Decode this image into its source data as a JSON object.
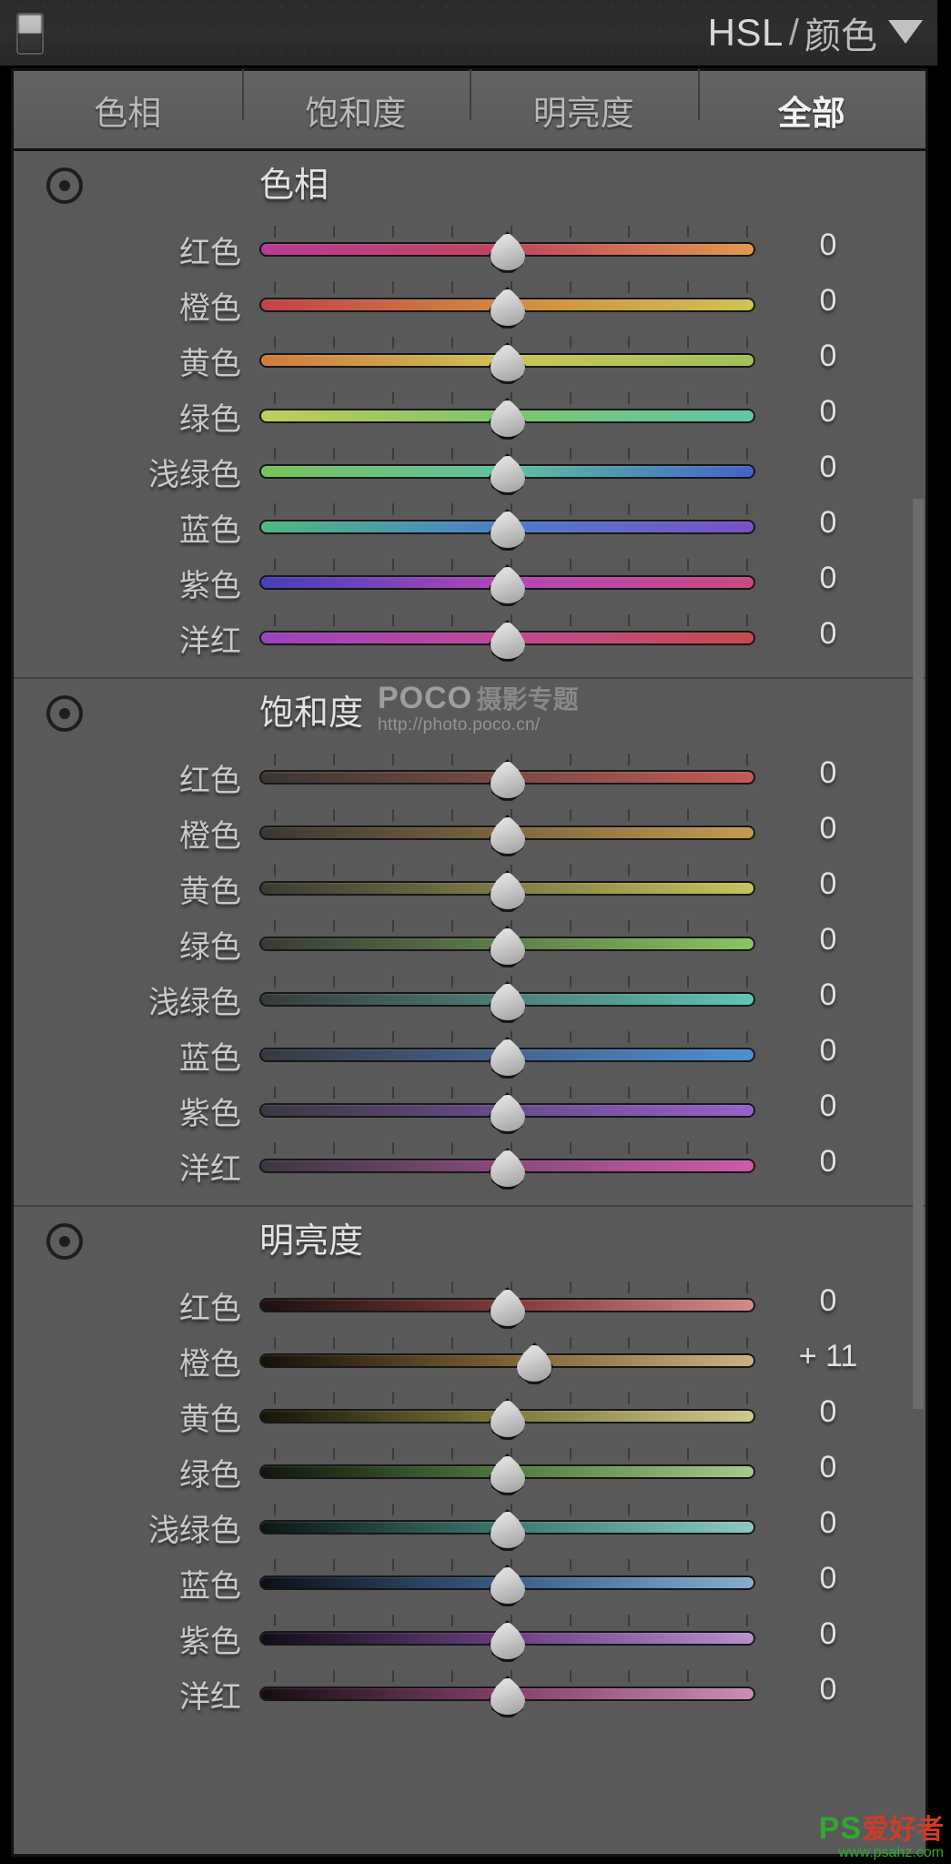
{
  "header": {
    "title_left": "HSL",
    "title_sep": "/",
    "title_right": "颜色",
    "caret_icon": "chevron-down-icon",
    "switch_icon": "panel-toggle-switch"
  },
  "tabs": [
    {
      "label": "色相",
      "active": false
    },
    {
      "label": "饱和度",
      "active": false
    },
    {
      "label": "明亮度",
      "active": false
    },
    {
      "label": "全部",
      "active": true
    }
  ],
  "watermark": {
    "brand": "POCO",
    "brand_cn": "摄影专题",
    "url": "http://photo.poco.cn/"
  },
  "bottom_watermark": {
    "logo": "PS",
    "text": "爱好者",
    "url": "www.psahz.com"
  },
  "sections": [
    {
      "id": "hue",
      "title": "色相",
      "target_icon": "target-adjust-icon",
      "rows": [
        {
          "label": "红色",
          "value": "0",
          "pos": 50,
          "from": "#b83b96",
          "mid": "#c0455c",
          "to": "#e09a4e"
        },
        {
          "label": "橙色",
          "value": "0",
          "pos": 50,
          "from": "#c2404a",
          "mid": "#d08a3e",
          "to": "#cfc254"
        },
        {
          "label": "黄色",
          "value": "0",
          "pos": 50,
          "from": "#d07a3c",
          "mid": "#ccc455",
          "to": "#9fc257"
        },
        {
          "label": "绿色",
          "value": "0",
          "pos": 50,
          "from": "#c2cc58",
          "mid": "#7dc470",
          "to": "#63c4a8"
        },
        {
          "label": "浅绿色",
          "value": "0",
          "pos": 50,
          "from": "#78c259",
          "mid": "#5fc0a0",
          "to": "#3f63c9"
        },
        {
          "label": "蓝色",
          "value": "0",
          "pos": 50,
          "from": "#4dba7f",
          "mid": "#4d7ccb",
          "to": "#7a4fc4"
        },
        {
          "label": "紫色",
          "value": "0",
          "pos": 50,
          "from": "#4340bb",
          "mid": "#b246b6",
          "to": "#c74a80"
        },
        {
          "label": "洋红",
          "value": "0",
          "pos": 50,
          "from": "#9a44bf",
          "mid": "#c24995",
          "to": "#c84a4a"
        }
      ]
    },
    {
      "id": "saturation",
      "title": "饱和度",
      "target_icon": "target-adjust-icon",
      "has_watermark": true,
      "rows": [
        {
          "label": "红色",
          "value": "0",
          "pos": 50,
          "from": "#3b3733",
          "mid": "#7b4a44",
          "to": "#c35a56"
        },
        {
          "label": "橙色",
          "value": "0",
          "pos": 50,
          "from": "#3a3732",
          "mid": "#7d6640",
          "to": "#c39c4e"
        },
        {
          "label": "黄色",
          "value": "0",
          "pos": 50,
          "from": "#3a3a33",
          "mid": "#7f7c46",
          "to": "#c9c45c"
        },
        {
          "label": "绿色",
          "value": "0",
          "pos": 50,
          "from": "#373a35",
          "mid": "#5f7e4c",
          "to": "#88c463"
        },
        {
          "label": "浅绿色",
          "value": "0",
          "pos": 50,
          "from": "#363a3a",
          "mid": "#4c7f78",
          "to": "#5fc4b4"
        },
        {
          "label": "蓝色",
          "value": "0",
          "pos": 50,
          "from": "#353840",
          "mid": "#46638e",
          "to": "#4f8fd1"
        },
        {
          "label": "紫色",
          "value": "0",
          "pos": 50,
          "from": "#3a3740",
          "mid": "#6a4c8d",
          "to": "#9a5fcb"
        },
        {
          "label": "洋红",
          "value": "0",
          "pos": 50,
          "from": "#3c3640",
          "mid": "#8a4a7e",
          "to": "#cc5aab"
        }
      ]
    },
    {
      "id": "luminance",
      "title": "明亮度",
      "target_icon": "target-adjust-icon",
      "rows": [
        {
          "label": "红色",
          "value": "0",
          "pos": 50,
          "from": "#1d1010",
          "mid": "#7d3a38",
          "to": "#d08d88"
        },
        {
          "label": "橙色",
          "value": "+ 11",
          "pos": 55.5,
          "from": "#151008",
          "mid": "#7d6136",
          "to": "#cdb184"
        },
        {
          "label": "黄色",
          "value": "0",
          "pos": 50,
          "from": "#151408",
          "mid": "#7e7a3a",
          "to": "#cfc98b"
        },
        {
          "label": "绿色",
          "value": "0",
          "pos": 50,
          "from": "#10150c",
          "mid": "#4f7a3f",
          "to": "#a6c98c"
        },
        {
          "label": "浅绿色",
          "value": "0",
          "pos": 50,
          "from": "#0c1514",
          "mid": "#3c7a70",
          "to": "#8cc9bf"
        },
        {
          "label": "蓝色",
          "value": "0",
          "pos": 50,
          "from": "#0b0f18",
          "mid": "#3a5d84",
          "to": "#8aadcf"
        },
        {
          "label": "紫色",
          "value": "0",
          "pos": 50,
          "from": "#120c18",
          "mid": "#6b3f82",
          "to": "#bb8ecc"
        },
        {
          "label": "洋红",
          "value": "0",
          "pos": 50,
          "from": "#160c12",
          "mid": "#84406a",
          "to": "#cc8eb2"
        }
      ]
    }
  ]
}
